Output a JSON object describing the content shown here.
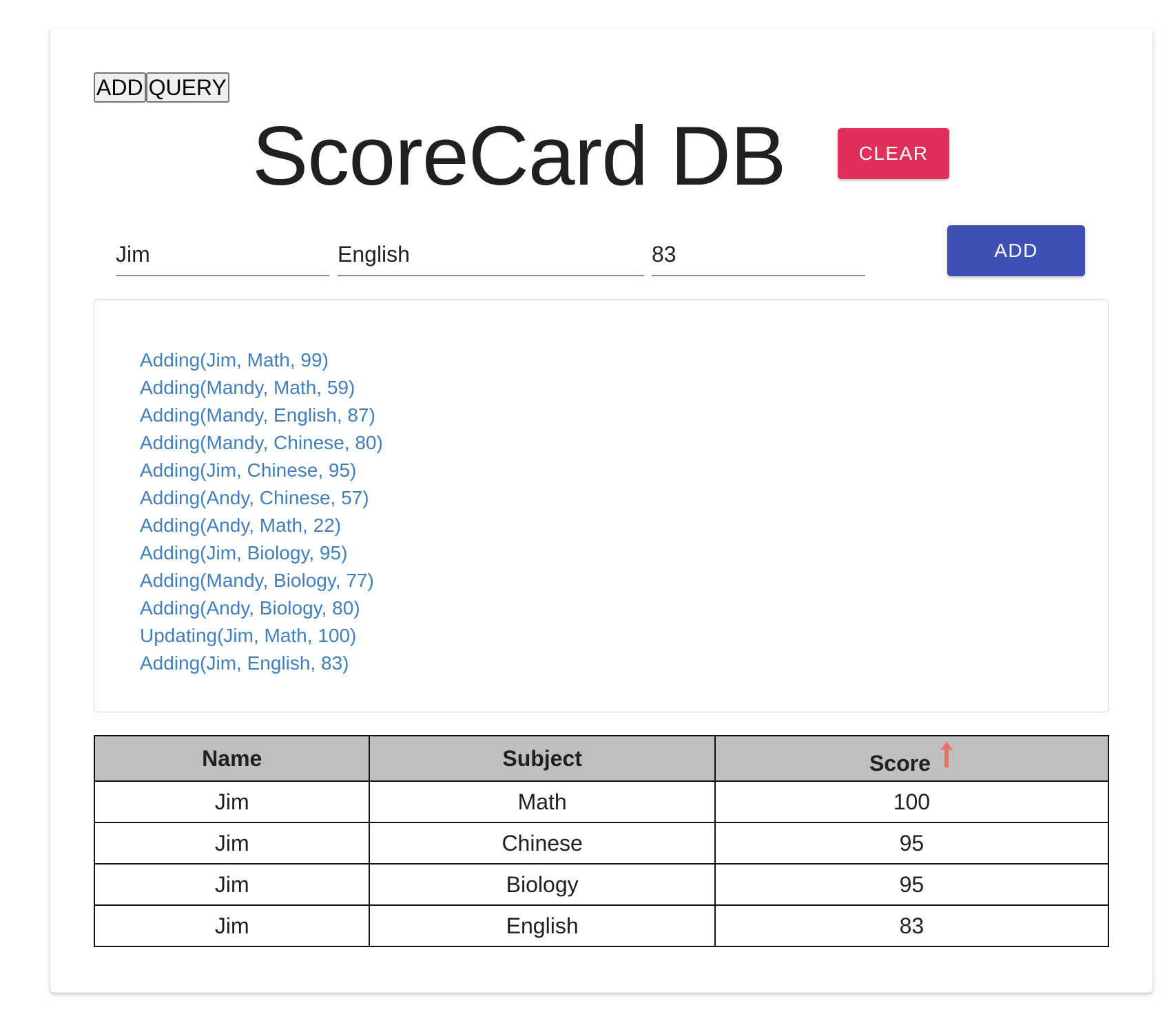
{
  "mode_tabs": {
    "add": "ADD",
    "query": "QUERY"
  },
  "title": "ScoreCard DB",
  "clear_button": "CLEAR",
  "form": {
    "name_value": "Jim",
    "subject_value": "English",
    "score_value": "83",
    "add_button": "ADD"
  },
  "log": [
    "Adding(Jim, Math, 99)",
    "Adding(Mandy, Math, 59)",
    "Adding(Mandy, English, 87)",
    "Adding(Mandy, Chinese, 80)",
    "Adding(Jim, Chinese, 95)",
    "Adding(Andy, Chinese, 57)",
    "Adding(Andy, Math, 22)",
    "Adding(Jim, Biology, 95)",
    "Adding(Mandy, Biology, 77)",
    "Adding(Andy, Biology, 80)",
    "Updating(Jim, Math, 100)",
    "Adding(Jim, English, 83)"
  ],
  "table": {
    "headers": [
      "Name",
      "Subject",
      "Score"
    ],
    "sort_icon": "arrow-up-icon",
    "rows": [
      [
        "Jim",
        "Math",
        "100"
      ],
      [
        "Jim",
        "Chinese",
        "95"
      ],
      [
        "Jim",
        "Biology",
        "95"
      ],
      [
        "Jim",
        "English",
        "83"
      ]
    ]
  },
  "colors": {
    "clear_button": "#e0305a",
    "add_button": "#3f51b5",
    "log_text": "#3f7fbf",
    "sort_arrow": "#e57368",
    "table_header_bg": "#bfbfbf"
  }
}
